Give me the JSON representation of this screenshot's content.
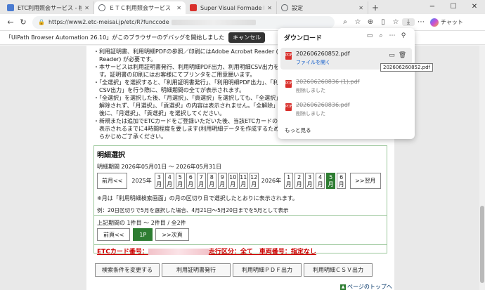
{
  "tabs": [
    {
      "label": "ETC利用照会サービス - 検索",
      "color": "#4a7bd1",
      "active": false
    },
    {
      "label": "ＥＴＣ利用照会サービス",
      "color": "#5f6368",
      "active": true
    },
    {
      "label": "Super Visual Formade Print",
      "color": "#d9302c",
      "active": false
    },
    {
      "label": "設定",
      "color": "#5f6368",
      "active": false
    }
  ],
  "toolbar": {
    "url": "https://www2.etc-meisai.jp/etc/R?funccode",
    "copilot_label": "チャット"
  },
  "infobar": {
    "message": "「UiPath Browser Automation 26.10」がこのブラウザーのデバッグを開始しました",
    "cancel_label": "キャンセル"
  },
  "bullets": [
    "・利用証明書、利用明細PDFの参照／印刷にはAdobe Acrobat Reader (Adobe",
    "　Reader) が必要です。",
    "・本サービスは利用証明書発行、利用明細PDF出力、利用明細CSV出力を行うもので",
    "　す。証明書の印刷にはお客様にてプリンタをご用意願います。",
    "・「全選択」を選択すると、「利用証明書発行」、「利用明細PDF出力」、「利用明細",
    "　CSV出力」を行う際に、明細期間の全てが表示されます。",
    "・「全選択」を選択した後、「月選択」、「貢選択」を選択しても、「全選択」は",
    "　解除されず、「月選択」、「貢選択」の内容は表示されません。「全解除」を選んだ",
    "　後に、「月選択」、「貢選択」を選択してください。",
    "・新規または追加でETCカードをご登録いただいた後、当該ETCカードの利用明細が",
    "　表示されるまでに4時間程度を要します(利用明細データを作成するため)ので、あ",
    "　らかじめご了承ください。"
  ],
  "selection": {
    "title": "明細選択",
    "period": "明細期間 2026年05月01日 〜 2026年05月31日",
    "prev_year": "前月<<",
    "next_month": ">>翌月",
    "year_2025": "2025年",
    "year_2026": "2026年",
    "months_2025": [
      "3月",
      "4月",
      "5月",
      "6月",
      "7月",
      "8月",
      "9月",
      "10月",
      "11月",
      "12月"
    ],
    "months_2026": [
      "1月",
      "2月",
      "3月",
      "4月",
      "5月",
      "6月"
    ],
    "selected_month": "5月",
    "note1": "※月は「利用明細検索画面」の月の区切り日で選択したとおりに表示されます。",
    "note2": "例：20日区切りで5月を選択した場合、4月21日〜5月20日までを5月として表示",
    "count": "上記期間の 1件目 〜 2件目 / 全2件",
    "prev_page": "前頁<<",
    "page": "1P",
    "next_page": ">>次頁",
    "etc_prefix": "ETCカード番号：",
    "etc_suffix": "走行区分：全て　車両番号：指定なし"
  },
  "actions": [
    "検索条件を変更する",
    "利用証明書発行",
    "利用明細ＰＤＦ出力",
    "利用明細ＣＳＶ出力"
  ],
  "page_top": "ページのトップへ",
  "downloads": {
    "title": "ダウンロード",
    "items": [
      {
        "name": "202606260852.pdf",
        "sub": "ファイルを開く"
      },
      {
        "name": "202606260836 (1).pdf",
        "sub": "削除しました"
      },
      {
        "name": "202606260836.pdf",
        "sub": "削除しました"
      }
    ],
    "more": "もっと見る",
    "tooltip": "202606260852.pdf"
  }
}
